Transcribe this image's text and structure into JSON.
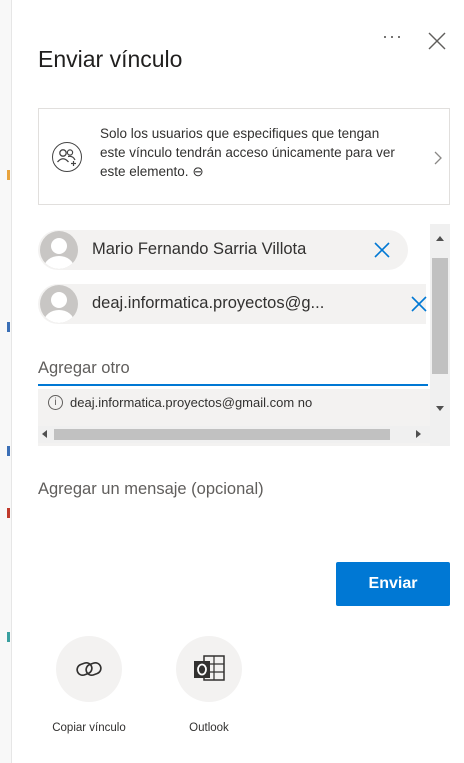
{
  "dialog": {
    "title": "Enviar vínculo",
    "more_label": "···",
    "permission_text": "Solo los usuarios que especifiques que tengan este vínculo tendrán acceso únicamente para ver este elemento.",
    "permission_icon_glyph": "⊖"
  },
  "recipients": [
    {
      "name": "Mario Fernando Sarria Villota"
    },
    {
      "name": "deaj.informatica.proyectos@g..."
    }
  ],
  "add_input": {
    "placeholder": "Agregar otro",
    "value": ""
  },
  "suggestion": {
    "info_glyph": "i",
    "text": "deaj.informatica.proyectos@gmail.com no"
  },
  "message": {
    "placeholder": "Agregar un mensaje (opcional)"
  },
  "send_button": {
    "label": "Enviar"
  },
  "share_options": [
    {
      "label": "Copiar vínculo",
      "icon": "link-icon"
    },
    {
      "label": "Outlook",
      "icon": "outlook-icon"
    }
  ],
  "colors": {
    "accent": "#0078d4",
    "pill_bg": "#f3f2f1",
    "text": "#323130"
  }
}
